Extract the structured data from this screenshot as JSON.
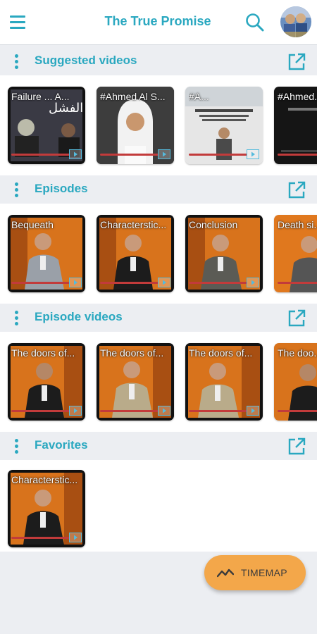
{
  "appbar": {
    "title": "The True Promise",
    "menu_icon": "hamburger-menu-icon",
    "search_icon": "search-icon",
    "avatar": "user-avatar"
  },
  "sections": [
    {
      "title": "Suggested videos",
      "cards": [
        {
          "label": "Failure ... A...",
          "thumb": "black-white-arabic-text"
        },
        {
          "label": "#Ahmed Al S...",
          "thumb": "man-keffiyeh"
        },
        {
          "label": "#A...",
          "thumb": "light-arabic-graphic"
        },
        {
          "label": "#Ahmed...",
          "thumb": "dark"
        }
      ]
    },
    {
      "title": "Episodes",
      "cards": [
        {
          "label": "Bequeath",
          "thumb": "studio-grey-suit"
        },
        {
          "label": "Characterstic...",
          "thumb": "studio-dark-suit"
        },
        {
          "label": "Conclusion",
          "thumb": "studio-grey-suit"
        },
        {
          "label": "Death si...",
          "thumb": "studio-orange"
        }
      ]
    },
    {
      "title": "Episode videos",
      "cards": [
        {
          "label": "The doors of...",
          "thumb": "studio-dark-suit"
        },
        {
          "label": "The doors of...",
          "thumb": "studio-beige-suit"
        },
        {
          "label": "The doors of...",
          "thumb": "studio-beige-suit"
        },
        {
          "label": "The doo...",
          "thumb": "studio-dark-suit"
        }
      ]
    },
    {
      "title": "Favorites",
      "cards": [
        {
          "label": "Characterstic...",
          "thumb": "studio-dark-suit"
        }
      ]
    }
  ],
  "fab": {
    "label": "TIMEMAP",
    "icon": "trend-chart-icon"
  },
  "colors": {
    "accent": "#2aa8c0",
    "fab": "#f3a74a",
    "background": "#eceef2",
    "progress": "#c23b3b"
  }
}
